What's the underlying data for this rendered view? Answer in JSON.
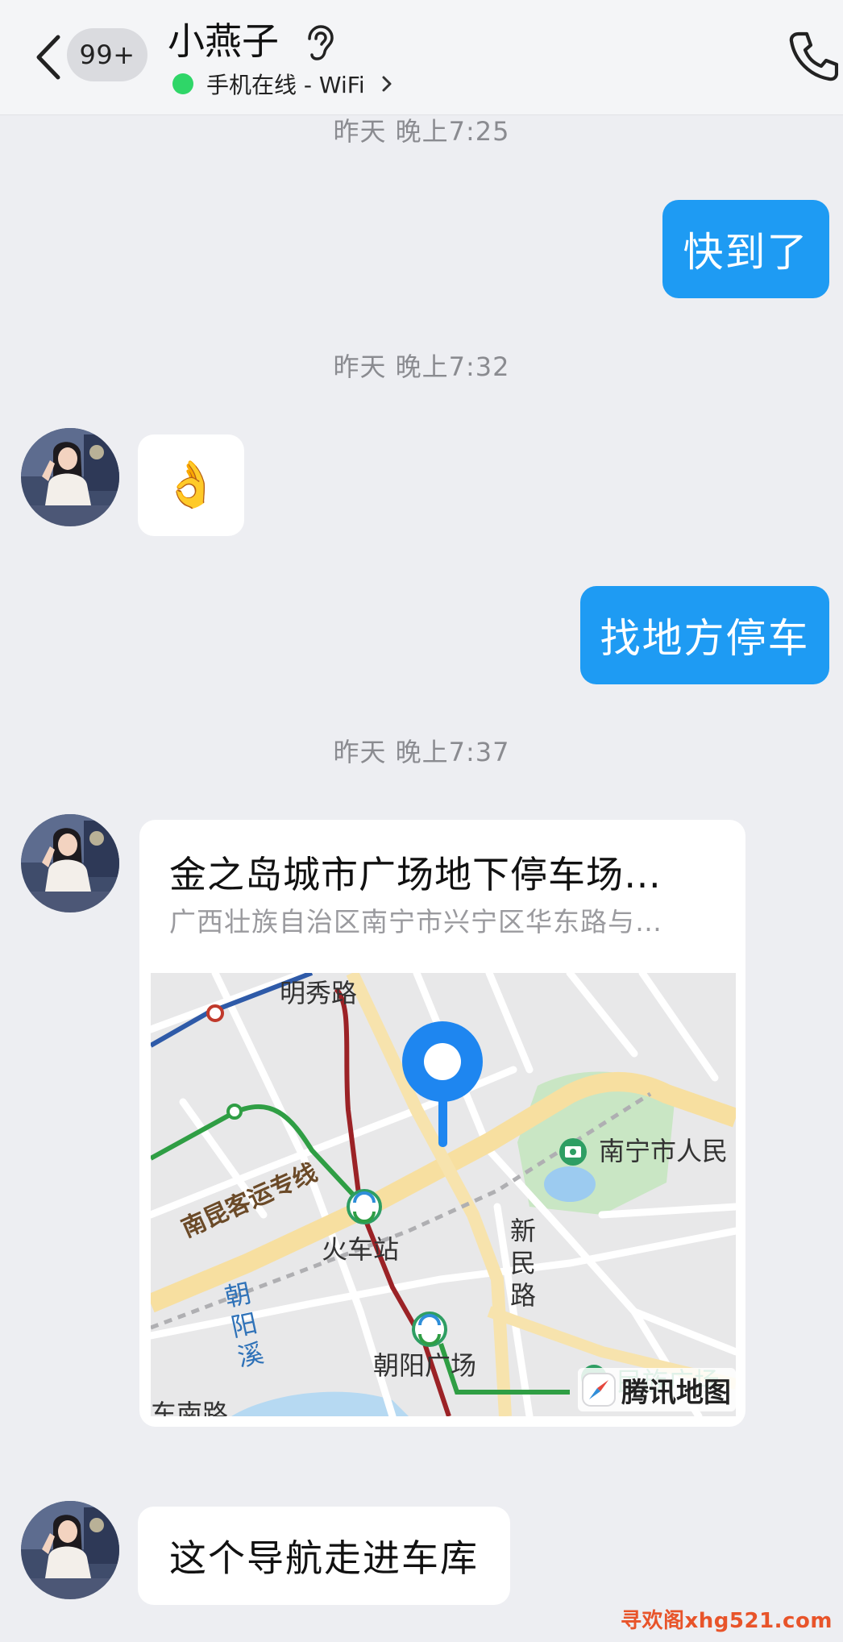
{
  "header": {
    "back_label": "<",
    "unread_count": "99+",
    "contact_name": "小燕子",
    "status_text": "手机在线 - WiFi",
    "icons": [
      "chevron-left-icon",
      "ear-icon",
      "chevron-right-icon",
      "phone-icon"
    ]
  },
  "messages": {
    "ts_1": "昨天 晚上7:25",
    "out_1": "快到了",
    "ts_2": "昨天 晚上7:32",
    "in_1_emoji": "👌",
    "out_2": "找地方停车",
    "ts_3": "昨天 晚上7:37",
    "location": {
      "title": "金之岛城市广场地下停车场…",
      "address": "广西壮族自治区南宁市兴宁区华东路与…",
      "map_labels": {
        "road_1": "明秀路",
        "park": "南宁市人民",
        "rail": "南昆客运专线",
        "station_1": "火车站",
        "road_2_chars": [
          "新",
          "民",
          "路"
        ],
        "river_chars": [
          "朝",
          "阳",
          "溪"
        ],
        "station_2": "朝阳广场",
        "station_3": "民族广场",
        "road_3": "东南路"
      },
      "brand": "腾讯地图"
    },
    "in_2": "这个导航走进车库"
  },
  "watermark": "寻欢阁xhg521.com",
  "colors": {
    "accent": "#1E9BF3",
    "online": "#2FD668",
    "background": "#EDEEF2",
    "watermark": "#E8542A"
  }
}
